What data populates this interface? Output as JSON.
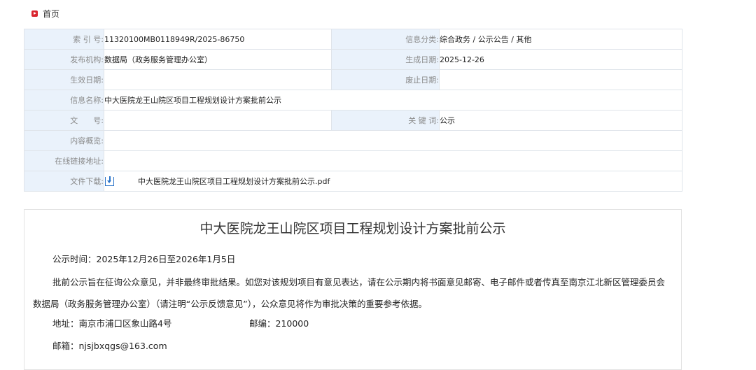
{
  "breadcrumb": {
    "home": "首页"
  },
  "meta": {
    "index_label": "索 引 号:",
    "index_value": "11320100MB0118949R/2025-86750",
    "category_label": "信息分类:",
    "category_value": "综合政务 / 公示公告 / 其他",
    "publisher_label": "发布机构:",
    "publisher_value": "数据局（政务服务管理办公室）",
    "created_label": "生成日期:",
    "created_value": "2025-12-26",
    "effective_label": "生效日期:",
    "effective_value": "",
    "expire_label": "废止日期:",
    "expire_value": "",
    "name_label": "信息名称:",
    "name_value": "中大医院龙王山院区项目工程规划设计方案批前公示",
    "docno_label": "文　　号:",
    "docno_value": "",
    "keyword_label": "关 键 词:",
    "keyword_value": "公示",
    "summary_label": "内容概览:",
    "summary_value": "",
    "link_label": "在线链接地址:",
    "link_value": "",
    "download_label": "文件下载:",
    "download_file": "中大医院龙王山院区项目工程规划设计方案批前公示.pdf"
  },
  "article": {
    "title": "中大医院龙王山院区项目工程规划设计方案批前公示",
    "period": "公示时间：2025年12月26日至2026年1月5日",
    "paragraph": "批前公示旨在征询公众意见，并非最终审批结果。如您对该规划项目有意见表达，请在公示期内将书面意见邮寄、电子邮件或者传真至南京江北新区管理委员会数据局（政务服务管理办公室）（请注明“公示反馈意见”），公众意见将作为审批决策的重要参考依据。",
    "address": "地址：南京市浦口区象山路4号",
    "postcode": "邮编：210000",
    "email": "邮箱：njsjbxqgs@163.com"
  }
}
